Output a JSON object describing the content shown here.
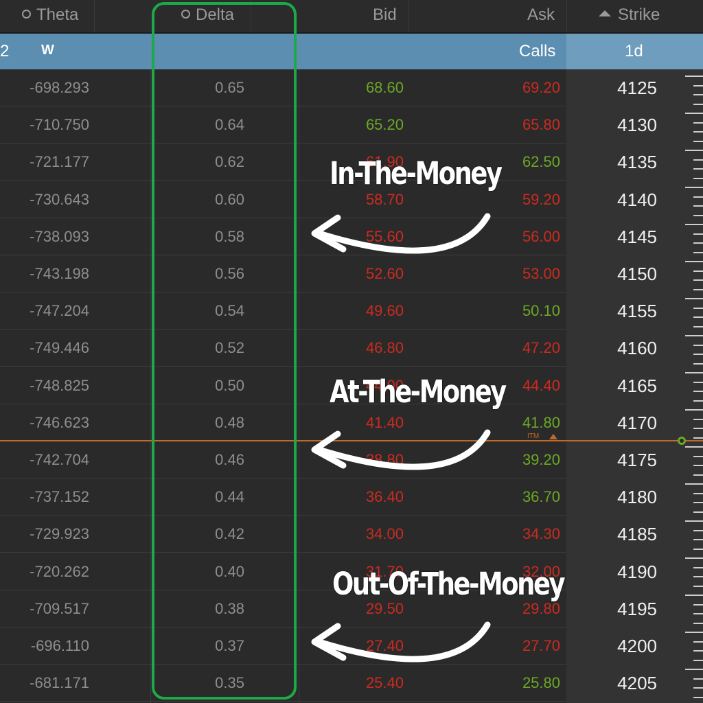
{
  "header": {
    "theta": "Theta",
    "delta": "Delta",
    "bid": "Bid",
    "ask": "Ask",
    "strike": "Strike"
  },
  "subheader": {
    "left_num": "2",
    "w_label": "W",
    "calls": "Calls",
    "expiry": "1d"
  },
  "rows": [
    {
      "theta": "-698.293",
      "delta": "0.65",
      "bid": "68.60",
      "ask": "69.20",
      "strike": "4125",
      "bid_dir": "up",
      "ask_dir": "down"
    },
    {
      "theta": "-710.750",
      "delta": "0.64",
      "bid": "65.20",
      "ask": "65.80",
      "strike": "4130",
      "bid_dir": "up",
      "ask_dir": "down"
    },
    {
      "theta": "-721.177",
      "delta": "0.62",
      "bid": "61.90",
      "ask": "62.50",
      "strike": "4135",
      "bid_dir": "down",
      "ask_dir": "up"
    },
    {
      "theta": "-730.643",
      "delta": "0.60",
      "bid": "58.70",
      "ask": "59.20",
      "strike": "4140",
      "bid_dir": "down",
      "ask_dir": "down"
    },
    {
      "theta": "-738.093",
      "delta": "0.58",
      "bid": "55.60",
      "ask": "56.00",
      "strike": "4145",
      "bid_dir": "down",
      "ask_dir": "down"
    },
    {
      "theta": "-743.198",
      "delta": "0.56",
      "bid": "52.60",
      "ask": "53.00",
      "strike": "4150",
      "bid_dir": "down",
      "ask_dir": "down"
    },
    {
      "theta": "-747.204",
      "delta": "0.54",
      "bid": "49.60",
      "ask": "50.10",
      "strike": "4155",
      "bid_dir": "down",
      "ask_dir": "up"
    },
    {
      "theta": "-749.446",
      "delta": "0.52",
      "bid": "46.80",
      "ask": "47.20",
      "strike": "4160",
      "bid_dir": "down",
      "ask_dir": "down"
    },
    {
      "theta": "-748.825",
      "delta": "0.50",
      "bid": "44.00",
      "ask": "44.40",
      "strike": "4165",
      "bid_dir": "down",
      "ask_dir": "down"
    },
    {
      "theta": "-746.623",
      "delta": "0.48",
      "bid": "41.40",
      "ask": "41.80",
      "strike": "4170",
      "bid_dir": "down",
      "ask_dir": "up"
    },
    {
      "theta": "-742.704",
      "delta": "0.46",
      "bid": "38.80",
      "ask": "39.20",
      "strike": "4175",
      "bid_dir": "down",
      "ask_dir": "up"
    },
    {
      "theta": "-737.152",
      "delta": "0.44",
      "bid": "36.40",
      "ask": "36.70",
      "strike": "4180",
      "bid_dir": "down",
      "ask_dir": "up"
    },
    {
      "theta": "-729.923",
      "delta": "0.42",
      "bid": "34.00",
      "ask": "34.30",
      "strike": "4185",
      "bid_dir": "down",
      "ask_dir": "down"
    },
    {
      "theta": "-720.262",
      "delta": "0.40",
      "bid": "31.70",
      "ask": "32.00",
      "strike": "4190",
      "bid_dir": "down",
      "ask_dir": "down"
    },
    {
      "theta": "-709.517",
      "delta": "0.38",
      "bid": "29.50",
      "ask": "29.80",
      "strike": "4195",
      "bid_dir": "down",
      "ask_dir": "down"
    },
    {
      "theta": "-696.110",
      "delta": "0.37",
      "bid": "27.40",
      "ask": "27.70",
      "strike": "4200",
      "bid_dir": "down",
      "ask_dir": "down"
    },
    {
      "theta": "-681.171",
      "delta": "0.35",
      "bid": "25.40",
      "ask": "25.80",
      "strike": "4205",
      "bid_dir": "down",
      "ask_dir": "up"
    }
  ],
  "itm_label": "ITM",
  "annotations": {
    "itm": "In-The-Money",
    "atm": "At-The-Money",
    "otm": "Out-Of-The-Money"
  },
  "colors": {
    "up": "#6ca824",
    "down": "#cc2a20",
    "highlight_box": "#1ea84a",
    "atm_line": "#c06a2a",
    "subheader": "#5b8eb1"
  }
}
